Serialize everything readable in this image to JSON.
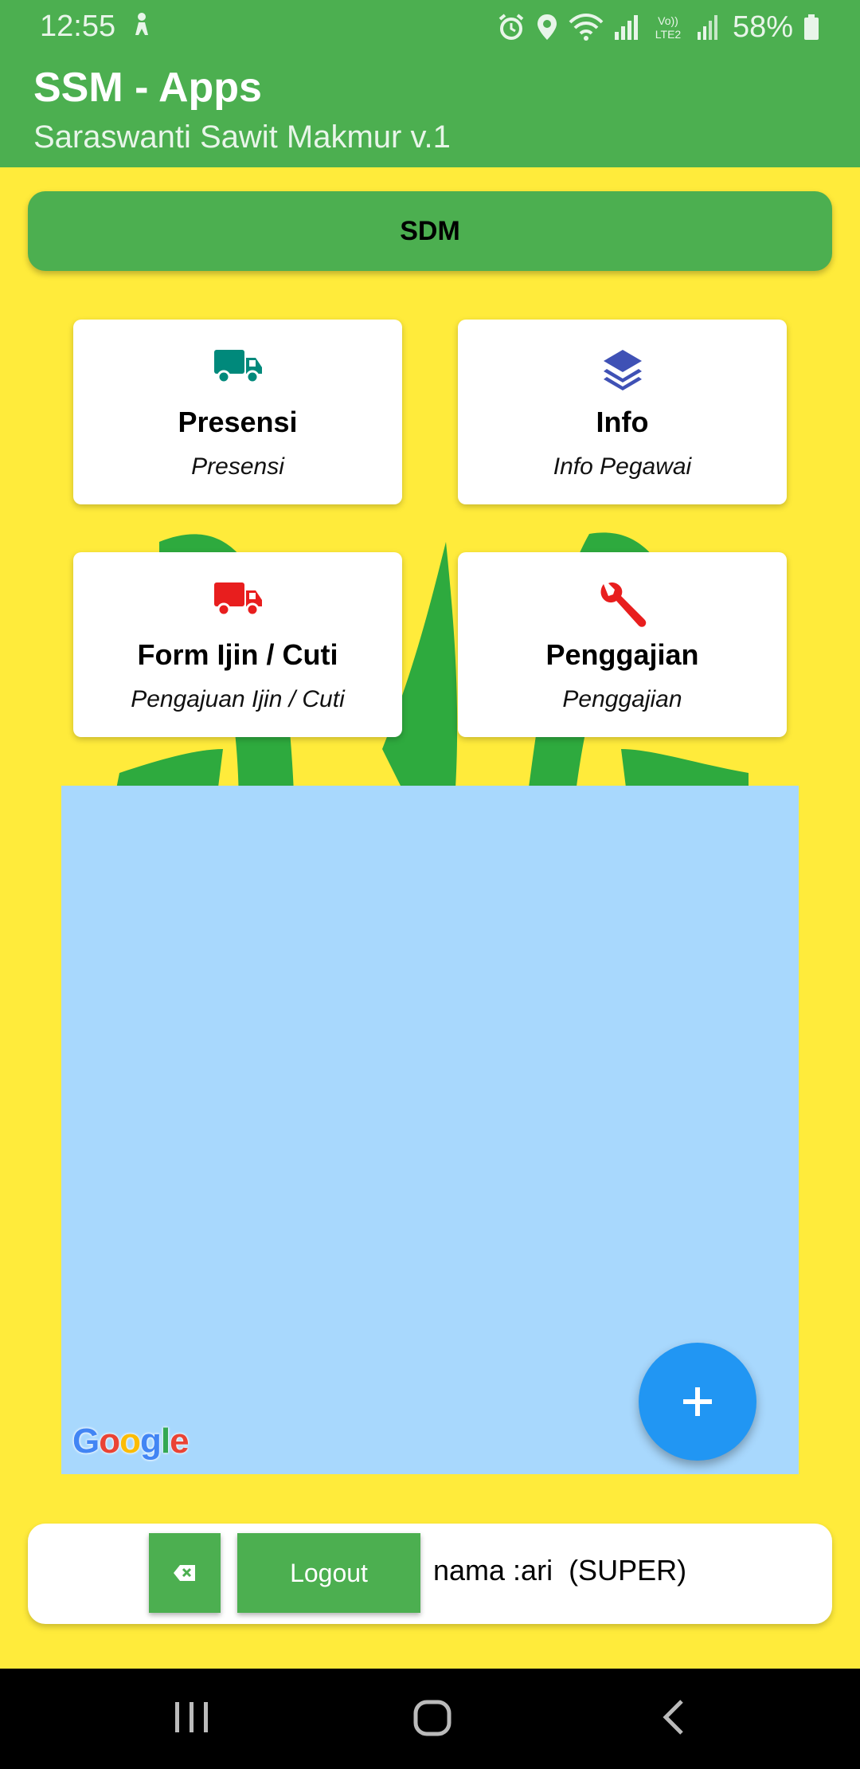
{
  "status_bar": {
    "time": "12:55",
    "battery": "58%",
    "icons": [
      "person-icon",
      "alarm-icon",
      "location-icon",
      "wifi-icon",
      "signal-icon",
      "volte-icon",
      "signal-icon-2",
      "battery-icon"
    ],
    "volte_text": "Vo)) LTE2"
  },
  "app_bar": {
    "title": "SSM - Apps",
    "subtitle": "Saraswanti Sawit Makmur v.1",
    "color": "#4caf50"
  },
  "section": {
    "label": "SDM"
  },
  "menu": [
    {
      "title": "Presensi",
      "subtitle": "Presensi",
      "icon": "truck-icon",
      "icon_color": "#00897b"
    },
    {
      "title": "Info",
      "subtitle": "Info Pegawai",
      "icon": "layers-icon",
      "icon_color": "#3f51b5"
    },
    {
      "title": "Form Ijin / Cuti",
      "subtitle": "Pengajuan Ijin / Cuti",
      "icon": "truck-icon",
      "icon_color": "#e81e1e"
    },
    {
      "title": "Penggajian",
      "subtitle": "Penggajian",
      "icon": "wrench-icon",
      "icon_color": "#e81e1e"
    }
  ],
  "map": {
    "provider_logo": "Google",
    "fab_icon": "plus-icon",
    "fab_color": "#2196f3",
    "background": "#a8d8fd"
  },
  "footer": {
    "clear_icon": "backspace-icon",
    "logout_label": "Logout",
    "user_text": "nama :ari  (SUPER)"
  },
  "colors": {
    "background": "#ffeb3b",
    "primary": "#4caf50"
  }
}
